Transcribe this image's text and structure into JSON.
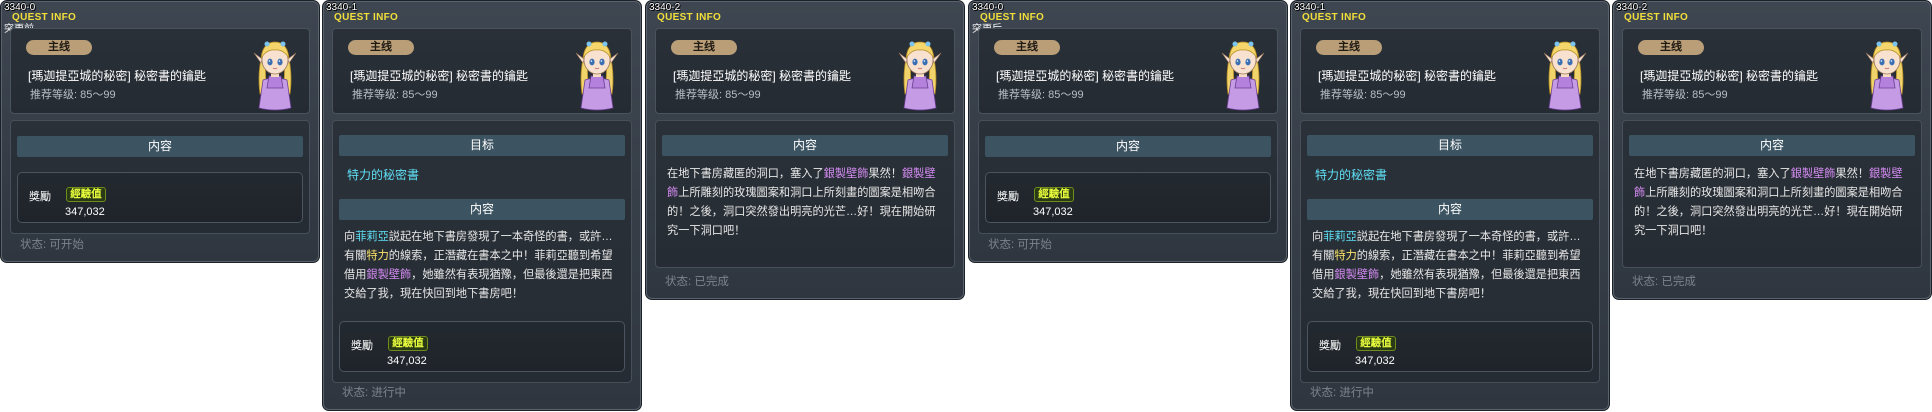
{
  "quest": {
    "header_label": "QUEST INFO",
    "type_badge": "主线",
    "title": "[瑪迦提亞城的秘密] 秘密書的鑰匙",
    "level_text": "推荐等级: 85～99",
    "target_header": "目标",
    "content_header": "内容",
    "target_item": "特力的秘密書",
    "reward_label": "獎勵",
    "exp_label": "經驗值",
    "exp_value": "347,032",
    "npc_icon": "elf-girl-npc-icon"
  },
  "texts": {
    "state1": {
      "p1": "向",
      "n1": "菲莉亞",
      "p2": "説起在地下書房發現了一本奇怪的書，或許…有關",
      "n2": "特力",
      "p3": "的線索，正潛藏在書本之中！菲莉亞聽到希望借用",
      "n3": "銀製壁飾",
      "p4": "，她雖然有表現猶豫，但最後還是把東西交給了我，現在快回到地下書房吧！"
    },
    "state2": {
      "p1": "在地下書房藏匿的洞口，塞入了",
      "n1": "銀製壁飾",
      "p2": "果然！",
      "n2": "銀製壁飾",
      "p3": "上所雕刻的玫瑰圖案和洞口上所刻畫的圖案是相吻合的！之後，洞口突然發出明亮的光芒…好！現在開始研究一下洞口吧！"
    }
  },
  "panels": [
    {
      "id": "3340-0",
      "subtitle": "突更前",
      "status": "状态: 可开始"
    },
    {
      "id": "3340-1",
      "subtitle": "",
      "status": "状态: 进行中"
    },
    {
      "id": "3340-2",
      "subtitle": "",
      "status": "状态: 已完成"
    },
    {
      "id": "3340-0",
      "subtitle": "突更后",
      "status": "状态: 可开始"
    },
    {
      "id": "3340-1",
      "subtitle": "",
      "status": "状态: 进行中"
    },
    {
      "id": "3340-2",
      "subtitle": "",
      "status": "状态: 已完成"
    }
  ],
  "colors": {
    "panel_bg": "#363d46",
    "section_header": "#3c5361",
    "badge": "#b99e78",
    "highlight_blue": "#5fe0f5",
    "highlight_purple": "#d58bf3",
    "exp_text": "#eaff3c",
    "quest_info_yellow": "#f2df3b",
    "status_gray": "#7b838d"
  }
}
